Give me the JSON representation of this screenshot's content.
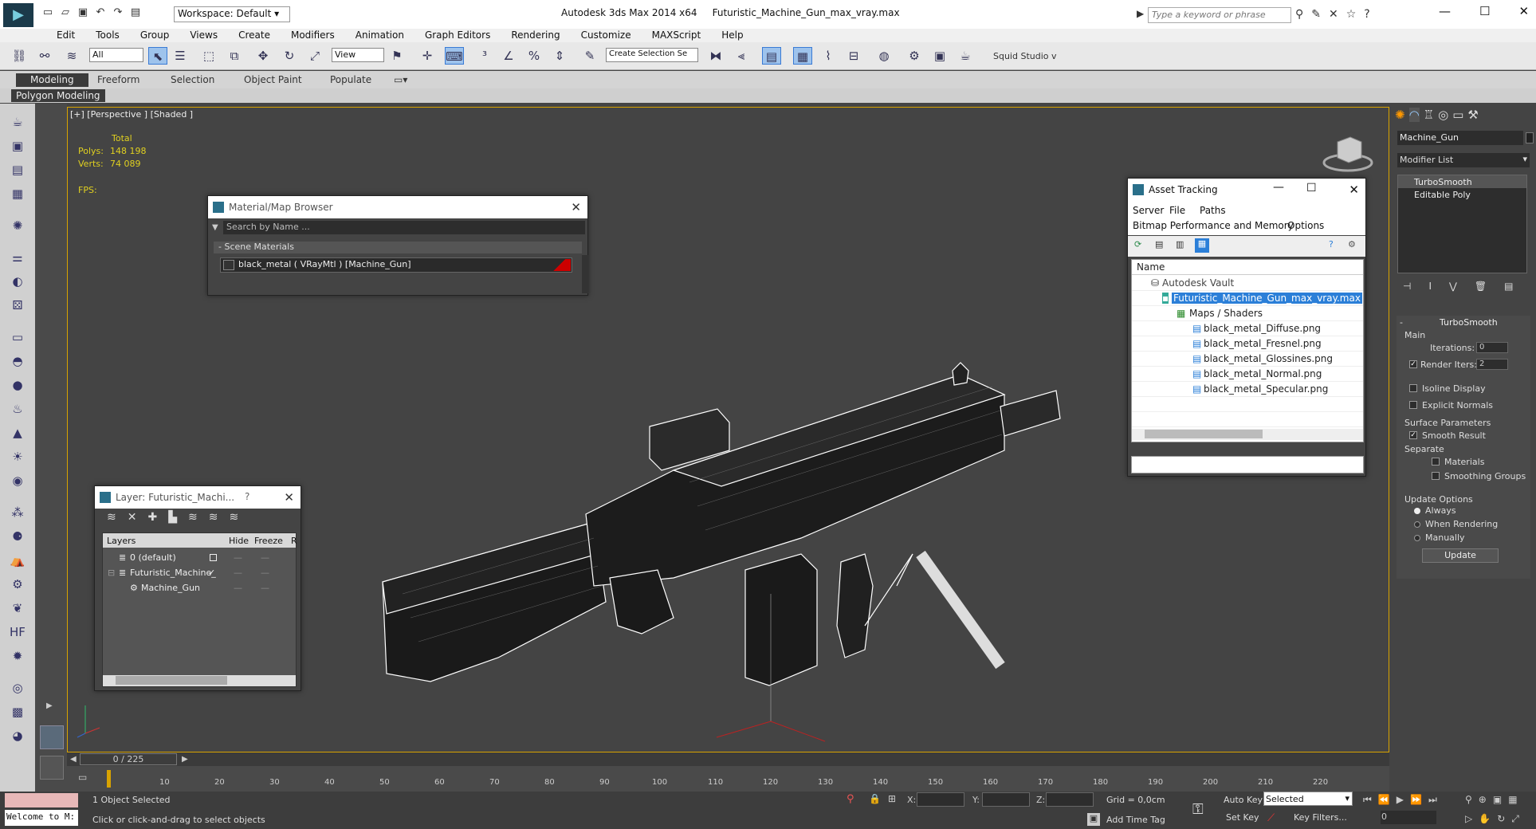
{
  "titlebar": {
    "workspace": "Workspace: Default",
    "app_name": "Autodesk 3ds Max  2014 x64",
    "file_name": "Futuristic_Machine_Gun_max_vray.max",
    "search_placeholder": "Type a keyword or phrase"
  },
  "menu": [
    "Edit",
    "Tools",
    "Group",
    "Views",
    "Create",
    "Modifiers",
    "Animation",
    "Graph Editors",
    "Rendering",
    "Customize",
    "MAXScript",
    "Help"
  ],
  "toolbar": {
    "selection_filter": "All",
    "ref_coord": "View",
    "named_selection": "Create Selection Se",
    "squid": "Squid Studio v"
  },
  "ribbon": {
    "tabs": [
      "Modeling",
      "Freeform",
      "Selection",
      "Object Paint",
      "Populate"
    ],
    "sub": "Polygon Modeling"
  },
  "viewport": {
    "label": "[+] [Perspective ] [Shaded ]",
    "total_label": "Total",
    "polys_label": "Polys:",
    "polys_value": "148 198",
    "verts_label": "Verts:",
    "verts_value": "74 089",
    "fps_label": "FPS:"
  },
  "material_browser": {
    "title": "Material/Map Browser",
    "search_placeholder": "Search by Name ...",
    "section": "Scene Materials",
    "item": "black_metal  ( VRayMtl ) [Machine_Gun]"
  },
  "layer_window": {
    "title": "Layer: Futuristic_Machi...",
    "help": "?",
    "col_layers": "Layers",
    "col_hide": "Hide",
    "col_freeze": "Freeze",
    "col_r": "R",
    "rows": [
      "0 (default)",
      "Futuristic_Machine_",
      "Machine_Gun"
    ]
  },
  "asset_tracking": {
    "title": "Asset Tracking",
    "menu": [
      "Server",
      "File",
      "Paths",
      "Bitmap Performance and Memory",
      "Options"
    ],
    "col_name": "Name",
    "vault": "Autodesk Vault",
    "file": "Futuristic_Machine_Gun_max_vray.max",
    "maps": "Maps / Shaders",
    "textures": [
      "black_metal_Diffuse.png",
      "black_metal_Fresnel.png",
      "black_metal_Glossines.png",
      "black_metal_Normal.png",
      "black_metal_Specular.png"
    ]
  },
  "command_panel": {
    "object_name": "Machine_Gun",
    "modifier_list": "Modifier List",
    "stack": [
      "TurboSmooth",
      "Editable Poly"
    ],
    "rollout_title": "TurboSmooth",
    "main": "Main",
    "iterations_label": "Iterations:",
    "iterations": "0",
    "render_iters_label": "Render Iters:",
    "render_iters": "2",
    "render_iters_checked": true,
    "isoline": "Isoline Display",
    "explicit_normals": "Explicit Normals",
    "surface_params": "Surface Parameters",
    "smooth_result": "Smooth Result",
    "separate": "Separate",
    "materials": "Materials",
    "smoothing_groups": "Smoothing Groups",
    "update_options": "Update Options",
    "always": "Always",
    "when_rendering": "When Rendering",
    "manually": "Manually",
    "update_button": "Update"
  },
  "timeline": {
    "frame": "0 / 225",
    "ticks": [
      "10",
      "20",
      "30",
      "40",
      "50",
      "60",
      "70",
      "80",
      "90",
      "100",
      "110",
      "120",
      "130",
      "140",
      "150",
      "160",
      "170",
      "180",
      "190",
      "200",
      "210",
      "220"
    ]
  },
  "status": {
    "maxscript": "Welcome to M:",
    "selected": "1 Object Selected",
    "prompt": "Click or click-and-drag to select objects",
    "x_label": "X:",
    "y_label": "Y:",
    "z_label": "Z:",
    "grid": "Grid = 0,0cm",
    "add_time_tag": "Add Time Tag",
    "auto_key": "Auto Key",
    "set_key": "Set Key",
    "selected_dd": "Selected",
    "key_filters": "Key Filters...",
    "frame_value": "0"
  }
}
